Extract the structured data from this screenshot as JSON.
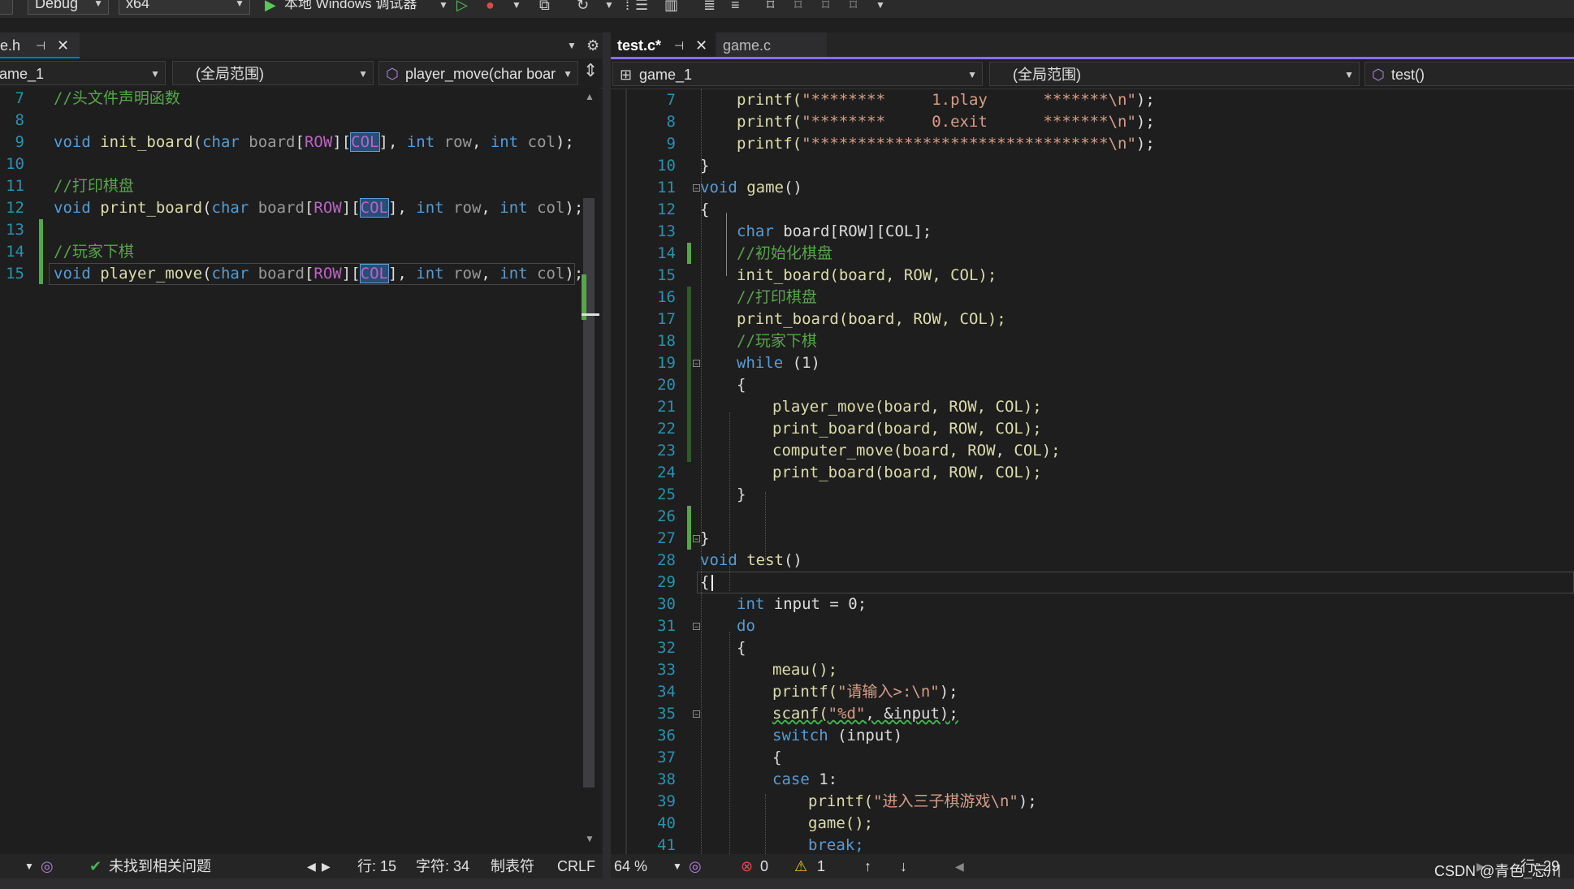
{
  "toolbar": {
    "config": "Debug",
    "platform": "x64",
    "run_label": "本地 Windows 调试器"
  },
  "left": {
    "tab_label": "e.h",
    "nav_project": "ame_1",
    "nav_scope": "(全局范围)",
    "nav_member": "player_move(char boar",
    "lines": [
      {
        "n": "7"
      },
      {
        "n": "8"
      },
      {
        "n": "9"
      },
      {
        "n": "10"
      },
      {
        "n": "11"
      },
      {
        "n": "12"
      },
      {
        "n": "13"
      },
      {
        "n": "14"
      },
      {
        "n": "15"
      }
    ],
    "code": {
      "c7": "//头文件声明函数",
      "c11": "//打印棋盘",
      "c14": "//玩家下棋",
      "kw_void": "void",
      "kw_char": "char",
      "kw_int": "int",
      "fn_init": "init_board",
      "fn_print": "print_board",
      "fn_player": "player_move",
      "board": "board",
      "row_macro": "ROW",
      "col_macro": "COL",
      "row_param": "row",
      "col_param": "col",
      "lp": "(",
      "rp_semi": ");",
      "lb": "[",
      "rb": "]",
      "comma": ", "
    },
    "status": {
      "issues": "未找到相关问题",
      "row": "行: 15",
      "char": "字符: 34",
      "tabs": "制表符",
      "eol": "CRLF"
    }
  },
  "right": {
    "tab_active": "test.c*",
    "tab_other": "game.c",
    "nav_project": "game_1",
    "nav_scope": "(全局范围)",
    "nav_member": "test()",
    "line_numbers": [
      "7",
      "8",
      "9",
      "10",
      "11",
      "12",
      "13",
      "14",
      "15",
      "16",
      "17",
      "18",
      "19",
      "20",
      "21",
      "22",
      "23",
      "24",
      "25",
      "26",
      "27",
      "28",
      "29",
      "30",
      "31",
      "32",
      "33",
      "34",
      "35",
      "36",
      "37",
      "38",
      "39",
      "40",
      "41"
    ],
    "code": {
      "l7a": "printf(",
      "l7s": "\"********     1.play      *******\\n\"",
      "l7b": ");",
      "l8a": "printf(",
      "l8s": "\"********     0.exit      *******\\n\"",
      "l8b": ");",
      "l9a": "printf(",
      "l9s": "\"********************************\\n\"",
      "l9b": ");",
      "l10": "}",
      "l11kw": "void",
      "l11fn": " game",
      "parens": "()",
      "l12": "{",
      "l13kw": "char",
      "l13rest": " board[ROW][COL];",
      "l14": "//初始化棋盘",
      "l15": "init_board(board, ROW, COL);",
      "l16": "//打印棋盘",
      "l17": "print_board(board, ROW, COL);",
      "l18": "//玩家下棋",
      "l19kw": "while",
      "l19rest": " (1)",
      "l20": "{",
      "l21": "player_move(board, ROW, COL);",
      "l22": "print_board(board, ROW, COL);",
      "l23": "computer_move(board, ROW, COL);",
      "l24": "print_board(board, ROW, COL);",
      "l25": "}",
      "l27": "}",
      "l28kw": "void",
      "l28fn": " test",
      "l29": "{",
      "l30kw": "int",
      "l30rest": " input = 0;",
      "l31": "do",
      "l32": "{",
      "l33": "meau();",
      "l34a": "printf(",
      "l34s": "\"请输入>:\\n\"",
      "l34b": ");",
      "l35a": "scanf(",
      "l35s": "\"%d\"",
      "l35b": ", &input);",
      "l36kw": "switch",
      "l36rest": " (input)",
      "l37": "{",
      "l38kw": "case",
      "l38rest": " 1:",
      "l39a": "printf(",
      "l39s": "\"进入三子棋游戏\\n\"",
      "l39b": ");",
      "l40": "game();",
      "l41": "break;"
    },
    "status": {
      "zoom": "64 %",
      "errors": "0",
      "warnings": "1",
      "row": "行: 29"
    }
  },
  "watermark": "CSDN @青色_忘川",
  "colors": {
    "keyword": "#569cd6",
    "comment": "#57a64a",
    "string": "#d69d85",
    "function": "#dcdcaa",
    "macro": "#bd63c5",
    "accent": "#007acc"
  }
}
